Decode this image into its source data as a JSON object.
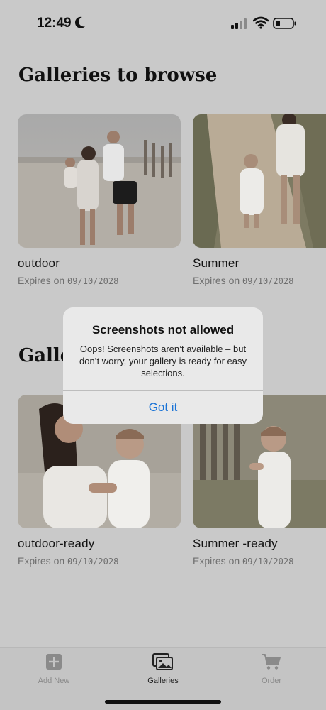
{
  "status_bar": {
    "time": "12:49"
  },
  "sections": [
    {
      "title": "Galleries to browse",
      "cards": [
        {
          "name": "outdoor",
          "expires_label": "Expires on",
          "expires_date": "09/10/2028",
          "photo": "family-beach-walk-photo"
        },
        {
          "name": "Summer",
          "expires_label": "Expires on",
          "expires_date": "09/10/2028",
          "photo": "toddler-path-photo"
        }
      ]
    },
    {
      "title": "Galle",
      "cards": [
        {
          "name": "outdoor-ready",
          "expires_label": "Expires on",
          "expires_date": "09/10/2028",
          "photo": "mother-child-photo"
        },
        {
          "name": "Summer -ready",
          "expires_label": "Expires on",
          "expires_date": "09/10/2028",
          "photo": "toddler-fence-photo"
        }
      ]
    }
  ],
  "alert": {
    "title": "Screenshots not allowed",
    "message": "Oops! Screenshots aren’t available – but don’t worry, your gallery is ready for easy selections.",
    "button": "Got it"
  },
  "tab_bar": {
    "items": [
      {
        "label": "Add New",
        "icon": "plus-square-icon",
        "active": false
      },
      {
        "label": "Galleries",
        "icon": "photos-icon",
        "active": true
      },
      {
        "label": "Order",
        "icon": "cart-icon",
        "active": false
      }
    ]
  },
  "colors": {
    "alert_button": "#1a73d6",
    "background_dimmed": "#c9c9c9"
  }
}
